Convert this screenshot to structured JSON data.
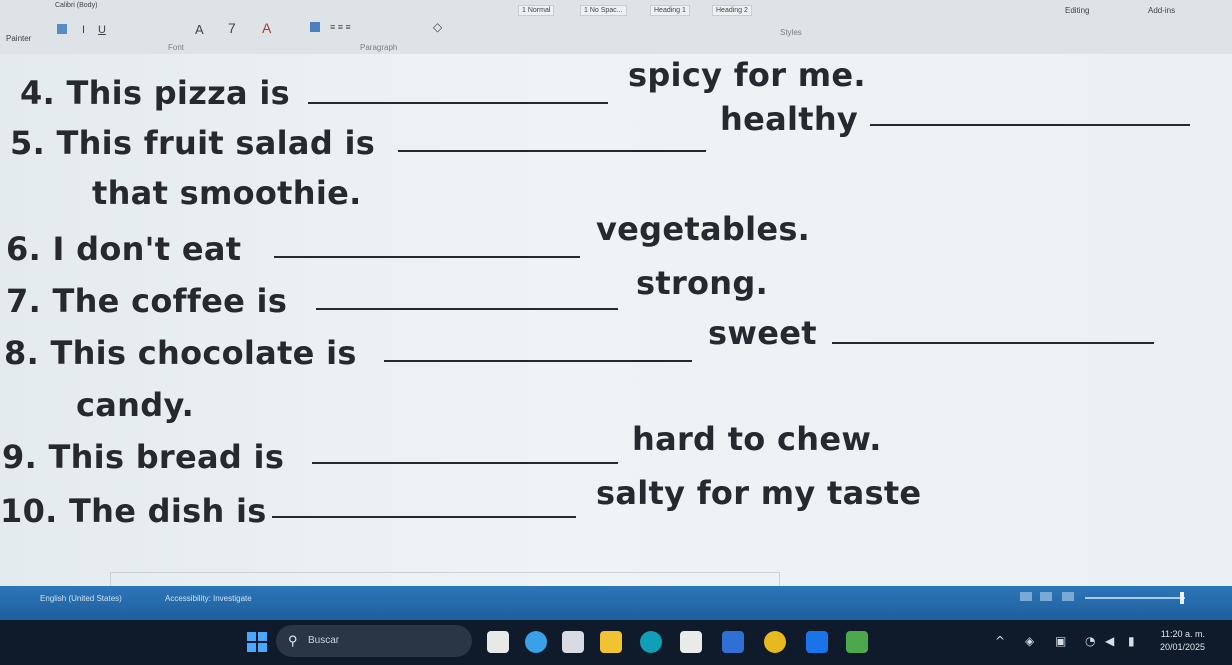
{
  "ribbon": {
    "font_name": "Calibri (Body)",
    "font_group": "Font",
    "paragraph_group": "Paragraph",
    "painter": "Painter",
    "styles": [
      "1 Normal",
      "1 No Spac...",
      "Heading 1",
      "Heading 2"
    ],
    "styles_group": "Styles",
    "editing": "Editing",
    "addins": "Add-ins"
  },
  "exercise": {
    "lines": [
      {
        "before": "4.   This pizza is",
        "after": "spicy for me."
      },
      {
        "before": "5.   This fruit salad is",
        "after": "healthy"
      },
      {
        "before": "that smoothie.",
        "after": ""
      },
      {
        "before": "6.   I don't eat",
        "after": "vegetables."
      },
      {
        "before": "7.   The coffee is",
        "after": "strong."
      },
      {
        "before": "8.   This chocolate is",
        "after": "sweet"
      },
      {
        "before": "candy.",
        "after": ""
      },
      {
        "before": "9.   This bread is",
        "after": "hard to chew."
      },
      {
        "before": "10. The dish is",
        "after": "salty for my taste"
      }
    ]
  },
  "statusbar": {
    "language": "English (United States)",
    "accessibility": "Accessibility: Investigate"
  },
  "taskbar": {
    "search_placeholder": "Buscar",
    "time": "11:20 a. m.",
    "date": "20/01/2025"
  },
  "colors": {
    "text": "#262a30",
    "status_blue": "#2468a8",
    "taskbar": "#0f1a2a"
  }
}
